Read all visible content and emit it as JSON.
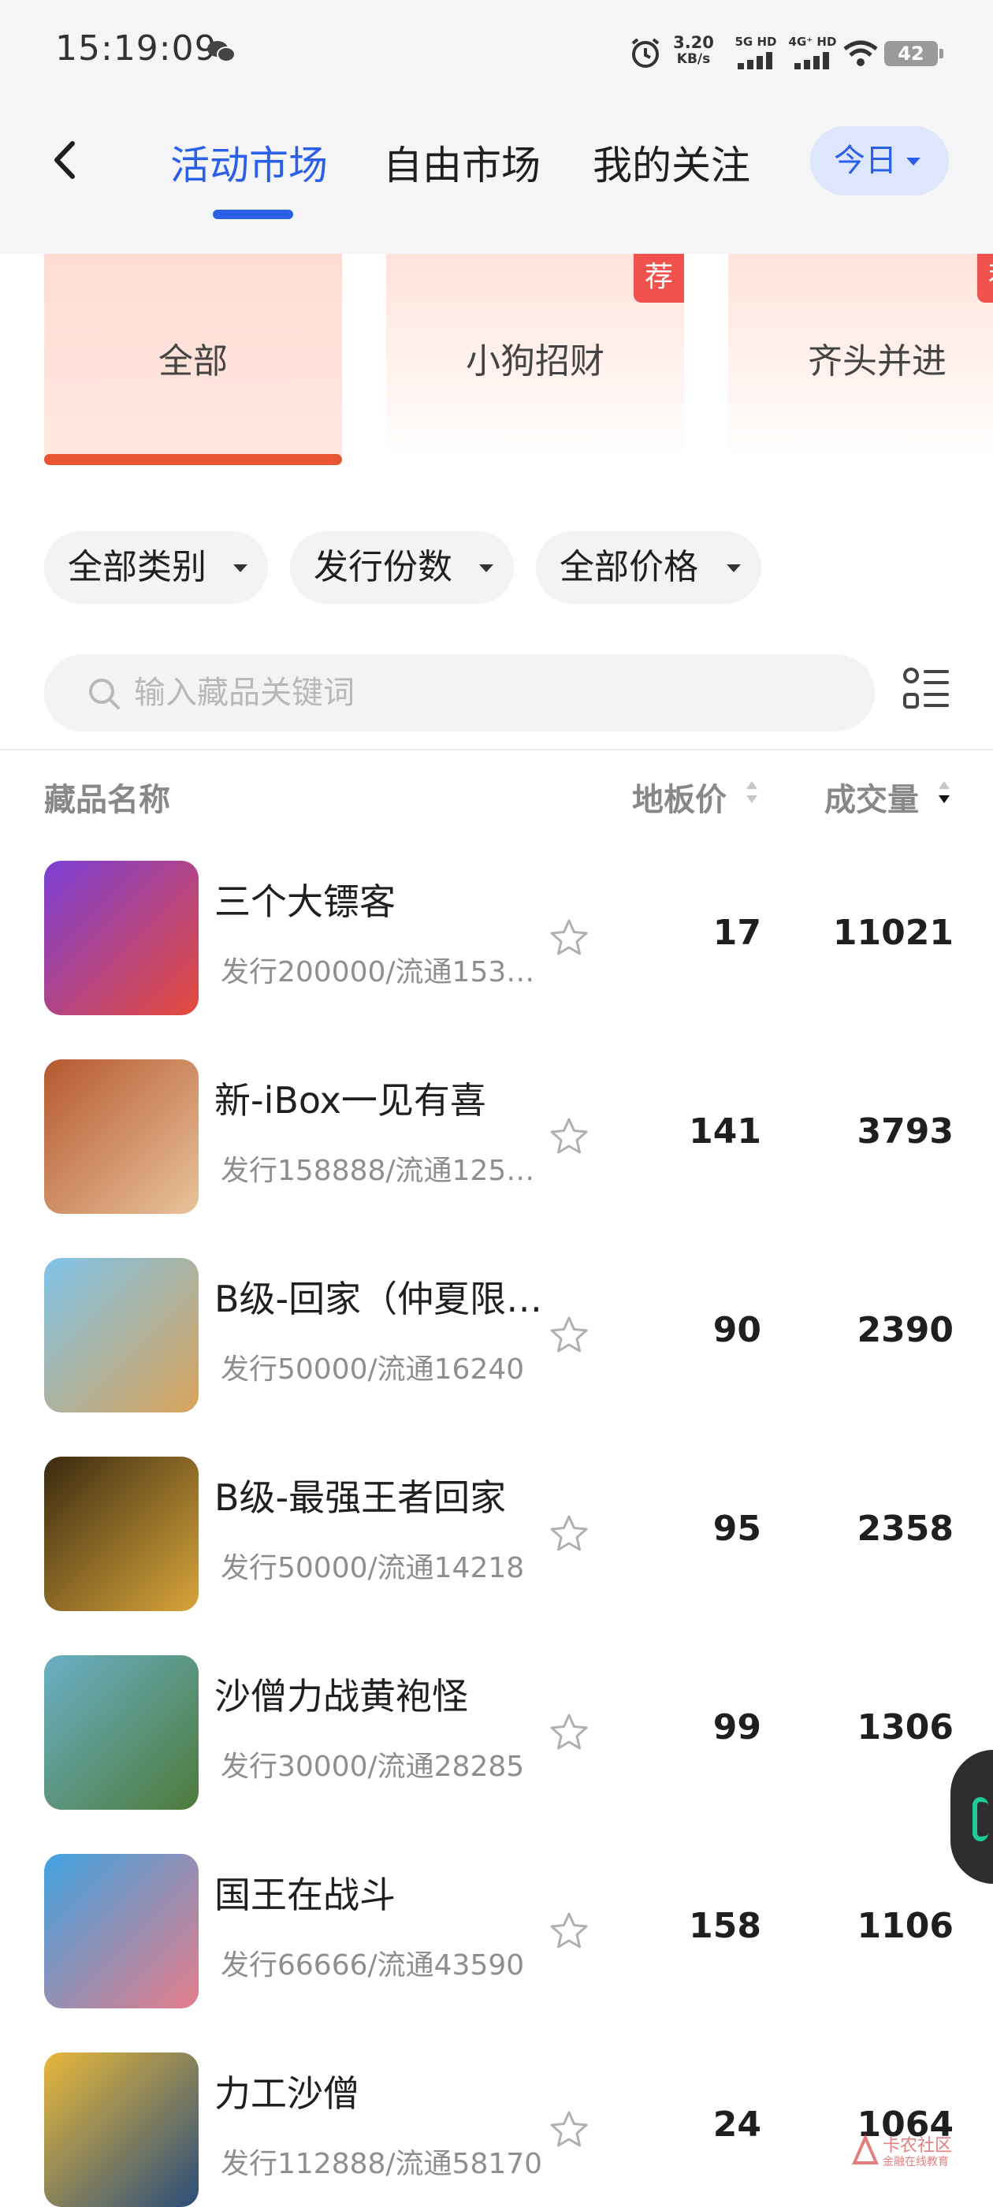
{
  "status_bar": {
    "time": "15:19:09",
    "speed_top": "3.20",
    "speed_bottom": "KB/s",
    "sim1_label": "5G HD",
    "sim2_label": "4G⁺ HD",
    "battery": "42"
  },
  "nav": {
    "tabs": [
      {
        "label": "活动市场",
        "active": true
      },
      {
        "label": "自由市场",
        "active": false
      },
      {
        "label": "我的关注",
        "active": false
      }
    ],
    "date_filter": "今日"
  },
  "categories": [
    {
      "label": "全部",
      "active": true,
      "badge": ""
    },
    {
      "label": "小狗招财",
      "active": false,
      "badge": "荐"
    },
    {
      "label": "齐头并进",
      "active": false,
      "badge": "荐"
    }
  ],
  "filters": [
    {
      "label": "全部类别"
    },
    {
      "label": "发行份数"
    },
    {
      "label": "全部价格"
    }
  ],
  "search": {
    "placeholder": "输入藏品关键词",
    "value": ""
  },
  "table": {
    "headers": {
      "name": "藏品名称",
      "floor_price": "地板价",
      "volume": "成交量"
    },
    "rows": [
      {
        "name": "三个大镖客",
        "sub": "发行200000/流通153…",
        "price": "17",
        "volume": "11021",
        "thumb_colors": [
          "#7b3fd6",
          "#e54a3a"
        ]
      },
      {
        "name": "新-iBox一见有喜",
        "sub": "发行158888/流通125…",
        "price": "141",
        "volume": "3793",
        "thumb_colors": [
          "#b5582f",
          "#e8c39a"
        ]
      },
      {
        "name": "B级-回家（仲夏限…",
        "sub": "发行50000/流通16240",
        "price": "90",
        "volume": "2390",
        "thumb_colors": [
          "#7fc4ea",
          "#d9a35a"
        ]
      },
      {
        "name": "B级-最强王者回家",
        "sub": "发行50000/流通14218",
        "price": "95",
        "volume": "2358",
        "thumb_colors": [
          "#3b2a10",
          "#d8a53a"
        ]
      },
      {
        "name": "沙僧力战黄袍怪",
        "sub": "发行30000/流通28285",
        "price": "99",
        "volume": "1306",
        "thumb_colors": [
          "#6ab0c7",
          "#4d7a3a"
        ]
      },
      {
        "name": "国王在战斗",
        "sub": "发行66666/流通43590",
        "price": "158",
        "volume": "1106",
        "thumb_colors": [
          "#3fa3e0",
          "#e47c8a"
        ]
      },
      {
        "name": "力工沙僧",
        "sub": "发行112888/流通58170",
        "price": "24",
        "volume": "1064",
        "thumb_colors": [
          "#e8b83a",
          "#2a4d7a"
        ]
      }
    ]
  },
  "watermark": {
    "line1": "卡农社区",
    "line2": "金融在线教育"
  },
  "colors": {
    "accent": "#2a5fe7",
    "category_bar": "#e85533",
    "badge": "#f0534e"
  }
}
